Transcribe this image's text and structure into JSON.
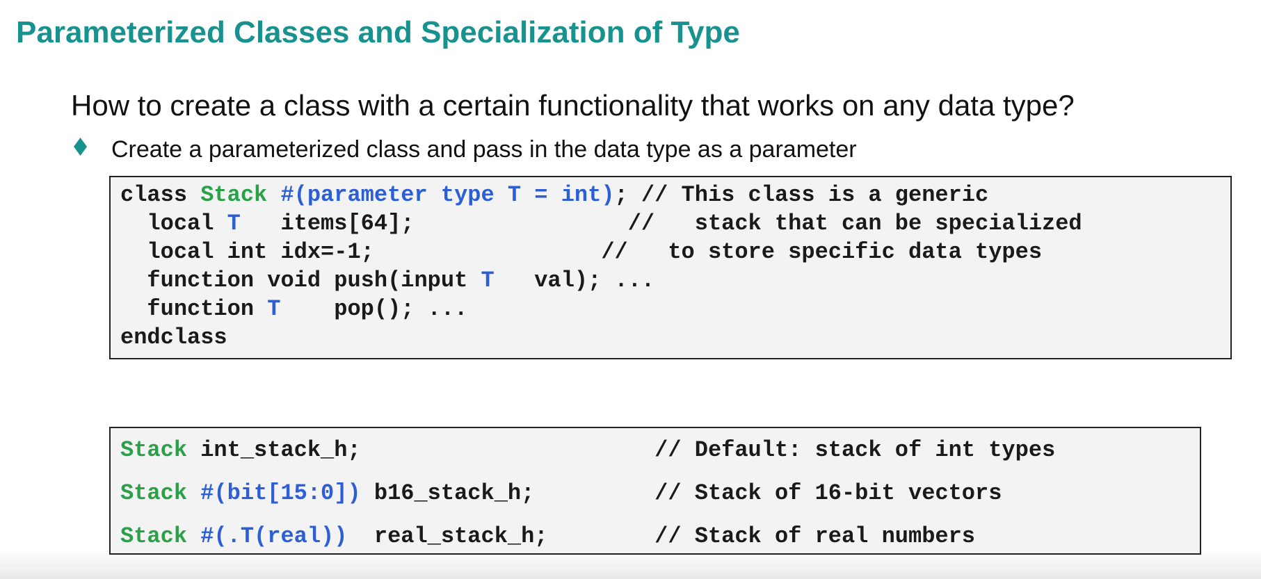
{
  "slide": {
    "title": "Parameterized Classes and Specialization of Type",
    "question": "How to create a class with a certain functionality that works on any data type?",
    "bullet": {
      "icon": "diamond-bullet-icon",
      "text": "Create a parameterized class and pass in the data type as a parameter"
    }
  },
  "code_block_1": {
    "lines": [
      [
        {
          "text": "class ",
          "style": "plain"
        },
        {
          "text": "Stack",
          "style": "class"
        },
        {
          "text": " #(parameter type T = int)",
          "style": "type"
        },
        {
          "text": "; // This class is a generic",
          "style": "plain"
        }
      ],
      [
        {
          "text": "  local ",
          "style": "plain"
        },
        {
          "text": "T",
          "style": "type"
        },
        {
          "text": "   items[64];                //   stack that can be specialized",
          "style": "plain"
        }
      ],
      [
        {
          "text": "  local int idx=-1;                 //   to store specific data types",
          "style": "plain"
        }
      ],
      [
        {
          "text": "  function void push(input ",
          "style": "plain"
        },
        {
          "text": "T",
          "style": "type"
        },
        {
          "text": "   val); ...",
          "style": "plain"
        }
      ],
      [
        {
          "text": "  function ",
          "style": "plain"
        },
        {
          "text": "T",
          "style": "type"
        },
        {
          "text": "    pop(); ...",
          "style": "plain"
        }
      ],
      [
        {
          "text": "endclass",
          "style": "plain"
        }
      ]
    ]
  },
  "code_block_2": {
    "lines": [
      [
        {
          "text": "Stack",
          "style": "class"
        },
        {
          "text": " int_stack_h;                      // Default: stack of int types",
          "style": "plain"
        }
      ],
      [
        {
          "text": "Stack",
          "style": "class"
        },
        {
          "text": " #(bit[15:0])",
          "style": "type"
        },
        {
          "text": " b16_stack_h;         // Stack of 16-bit vectors",
          "style": "plain"
        }
      ],
      [
        {
          "text": "Stack",
          "style": "class"
        },
        {
          "text": " #(.T(real))",
          "style": "type"
        },
        {
          "text": "  real_stack_h;        // Stack of real numbers",
          "style": "plain"
        }
      ]
    ]
  },
  "colors": {
    "title": "#17928e",
    "class_keyword": "#2aa147",
    "type_keyword": "#2c5fd6",
    "text": "#1a1a1a"
  }
}
